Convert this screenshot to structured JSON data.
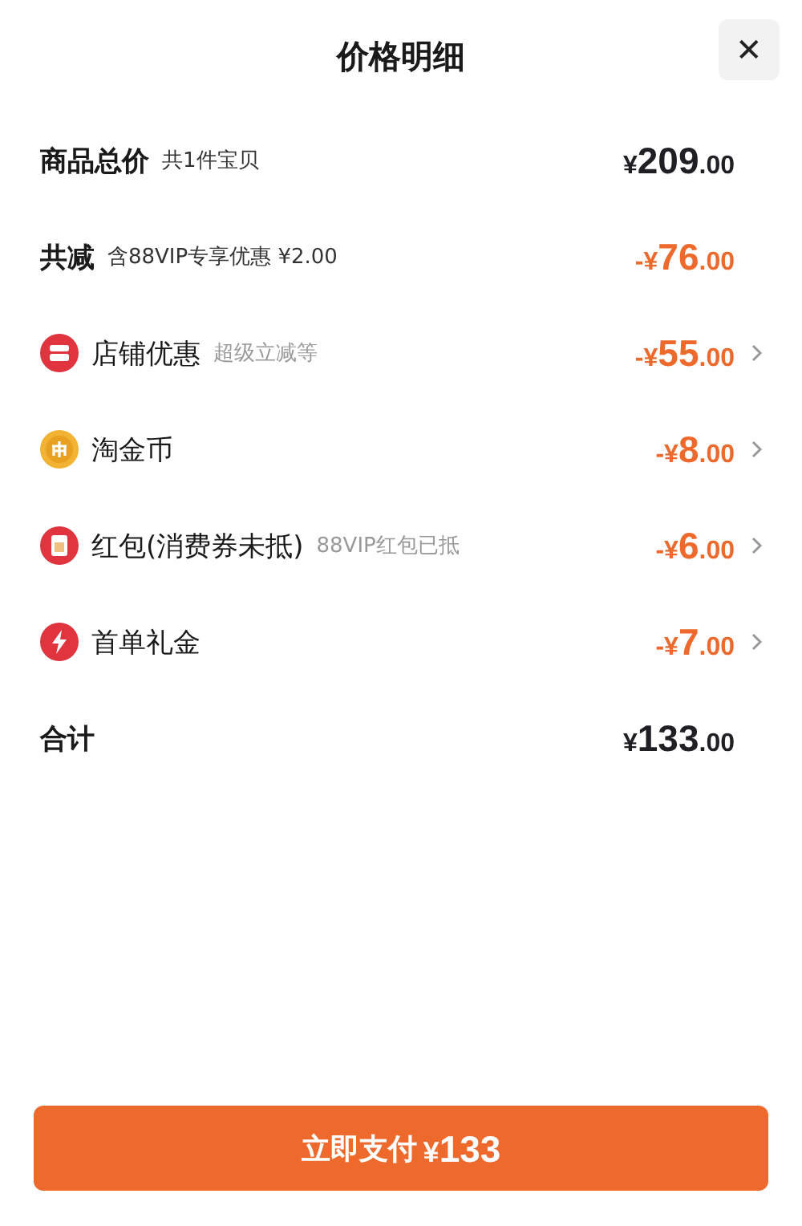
{
  "header": {
    "title": "价格明细",
    "close": "✕"
  },
  "rows": [
    {
      "kind": "heading",
      "label": "商品总价",
      "note": "共1件宝贝",
      "amount": "¥209.00",
      "negative": false
    },
    {
      "kind": "heading",
      "label": "共减",
      "note": "含88VIP专享优惠 ¥2.00",
      "amount": "-¥76.00",
      "negative": true
    },
    {
      "kind": "shop",
      "label": "店铺优惠",
      "note": "超级立减等",
      "amount": "-¥55.00",
      "negative": true
    },
    {
      "kind": "coin",
      "label": "淘金币",
      "amount": "-¥8.00",
      "negative": true
    },
    {
      "kind": "envelope",
      "label": "红包(消费券未抵)",
      "note": "88VIP红包已抵",
      "amount": "-¥6.00",
      "negative": true
    },
    {
      "kind": "bolt",
      "label": "首单礼金",
      "amount": "-¥7.00",
      "negative": true
    },
    {
      "kind": "heading",
      "label": "合计",
      "amount": "¥133.00",
      "negative": false
    }
  ],
  "pay_button": {
    "label": "立即支付",
    "amount": "¥133"
  }
}
